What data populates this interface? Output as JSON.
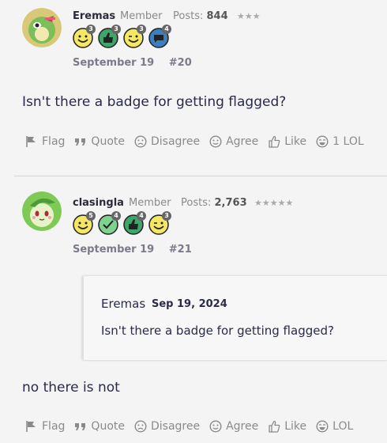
{
  "posts": [
    {
      "username": "Eremas",
      "role": "Member",
      "posts_label": "Posts:",
      "posts_count": "844",
      "rank_stars": "★★★",
      "badges": [
        {
          "icon": "smile-badge-icon",
          "count": "3"
        },
        {
          "icon": "thumbs-up-badge-icon",
          "count": "3"
        },
        {
          "icon": "wink-badge-icon",
          "count": "3"
        },
        {
          "icon": "comment-badge-icon",
          "count": "4"
        }
      ],
      "date": "September 19",
      "post_number": "#20",
      "body": "Isn't there a badge for getting flagged?",
      "actions": {
        "flag": "Flag",
        "quote": "Quote",
        "disagree": "Disagree",
        "agree": "Agree",
        "like": "Like",
        "lol": "1 LOL"
      }
    },
    {
      "username": "clasingla",
      "role": "Member",
      "posts_label": "Posts:",
      "posts_count": "2,763",
      "rank_stars": "★★★★★",
      "badges": [
        {
          "icon": "smile-badge-icon",
          "count": "5"
        },
        {
          "icon": "check-badge-icon",
          "count": "4"
        },
        {
          "icon": "thumbs-up-badge-icon",
          "count": "4"
        },
        {
          "icon": "wink-badge-icon",
          "count": "3"
        }
      ],
      "date": "September 19",
      "post_number": "#21",
      "quote": {
        "author": "Eremas",
        "date": "Sep 19, 2024",
        "text": "Isn't there a badge for getting flagged?"
      },
      "body": "no there is not",
      "actions": {
        "flag": "Flag",
        "quote": "Quote",
        "disagree": "Disagree",
        "agree": "Agree",
        "like": "Like",
        "lol": "LOL"
      }
    }
  ],
  "colors": {
    "badge_yellow": "#f5e663",
    "badge_green": "#3fa66a",
    "badge_blue": "#3a7fbf",
    "text_main": "#2a2a4a",
    "text_muted": "#8a8a8a"
  }
}
